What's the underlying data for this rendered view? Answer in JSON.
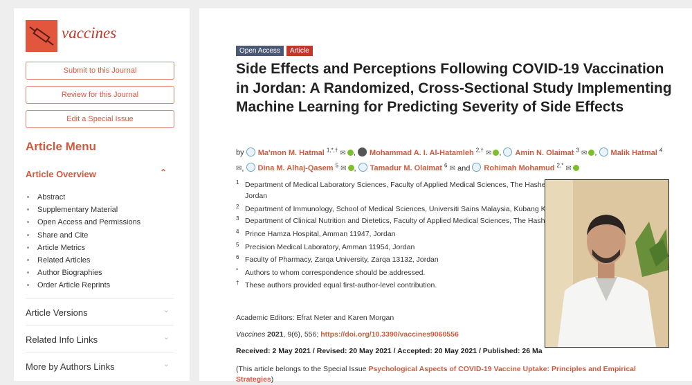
{
  "journal": {
    "name": "vaccines"
  },
  "sidebar": {
    "buttons": [
      "Submit to this Journal",
      "Review for this Journal",
      "Edit a Special Issue"
    ],
    "menu_title": "Article Menu",
    "overview_title": "Article Overview",
    "overview_items": [
      "Abstract",
      "Supplementary Material",
      "Open Access and Permissions",
      "Share and Cite",
      "Article Metrics",
      "Related Articles",
      "Author Biographies",
      "Order Article Reprints"
    ],
    "sections": [
      "Article Versions",
      "Related Info Links",
      "More by Authors Links"
    ]
  },
  "article": {
    "badges": {
      "open_access": "Open Access",
      "type": "Article"
    },
    "title": "Side Effects and Perceptions Following COVID-19 Vaccination in Jordan: A Randomized, Cross-Sectional Study Implementing Machine Learning for Predicting Severity of Side Effects",
    "by": "by",
    "authors": [
      {
        "name": "Ma'mon M. Hatmal",
        "sup": "1,*,†"
      },
      {
        "name": "Mohammad A. I. Al-Hatamleh",
        "sup": "2,†"
      },
      {
        "name": "Amin N. Olaimat",
        "sup": "3"
      },
      {
        "name": "Malik Hatmal",
        "sup": "4"
      },
      {
        "name": "Dina M. Alhaj-Qasem",
        "sup": "5"
      },
      {
        "name": "Tamadur M. Olaimat",
        "sup": "6"
      },
      {
        "name": "Rohimah Mohamud",
        "sup": "2,*"
      }
    ],
    "and_word": "and",
    "affiliations": [
      {
        "n": "1",
        "text": "Department of Medical Laboratory Sciences, Faculty of Applied Medical Sciences, The Hashemite University, Zarqa 13133, Jordan"
      },
      {
        "n": "2",
        "text": "Department of Immunology, School of Medical Sciences, Universiti Sains Malaysia, Kubang K"
      },
      {
        "n": "3",
        "text": "Department of Clinical Nutrition and Dietetics, Faculty of Applied Medical Sciences, The Hash Jordan"
      },
      {
        "n": "4",
        "text": "Prince Hamza Hospital, Amman 11947, Jordan"
      },
      {
        "n": "5",
        "text": "Precision Medical Laboratory, Amman 11954, Jordan"
      },
      {
        "n": "6",
        "text": "Faculty of Pharmacy, Zarqa University, Zarqa 13132, Jordan"
      },
      {
        "n": "*",
        "text": "Authors to whom correspondence should be addressed."
      },
      {
        "n": "†",
        "text": "These authors provided equal first-author-level contribution."
      }
    ],
    "editors": "Academic Editors: Efrat Neter and Karen Morgan",
    "citation": {
      "journal": "Vaccines",
      "year": "2021",
      "rest": ", 9(6), 556; ",
      "doi": "https://doi.org/10.3390/vaccines9060556"
    },
    "dates": "Received: 2 May 2021 / Revised: 20 May 2021 / Accepted: 20 May 2021 / Published: 26 Ma",
    "special_issue": {
      "prefix": "(This article belongs to the Special Issue ",
      "link": "Psychological Aspects of COVID-19 Vaccine Uptake: Principles and Empirical Strategies",
      "suffix": ")"
    }
  },
  "colors": {
    "brand": "#d05a3f",
    "open_access_badge": "#4b5876",
    "article_badge": "#c0392b",
    "orcid": "#7cbf2d"
  },
  "icons": [
    "syringe-icon",
    "chevron-up-icon",
    "chevron-down-icon",
    "mail-icon",
    "orcid-icon",
    "author-avatar-icon"
  ]
}
